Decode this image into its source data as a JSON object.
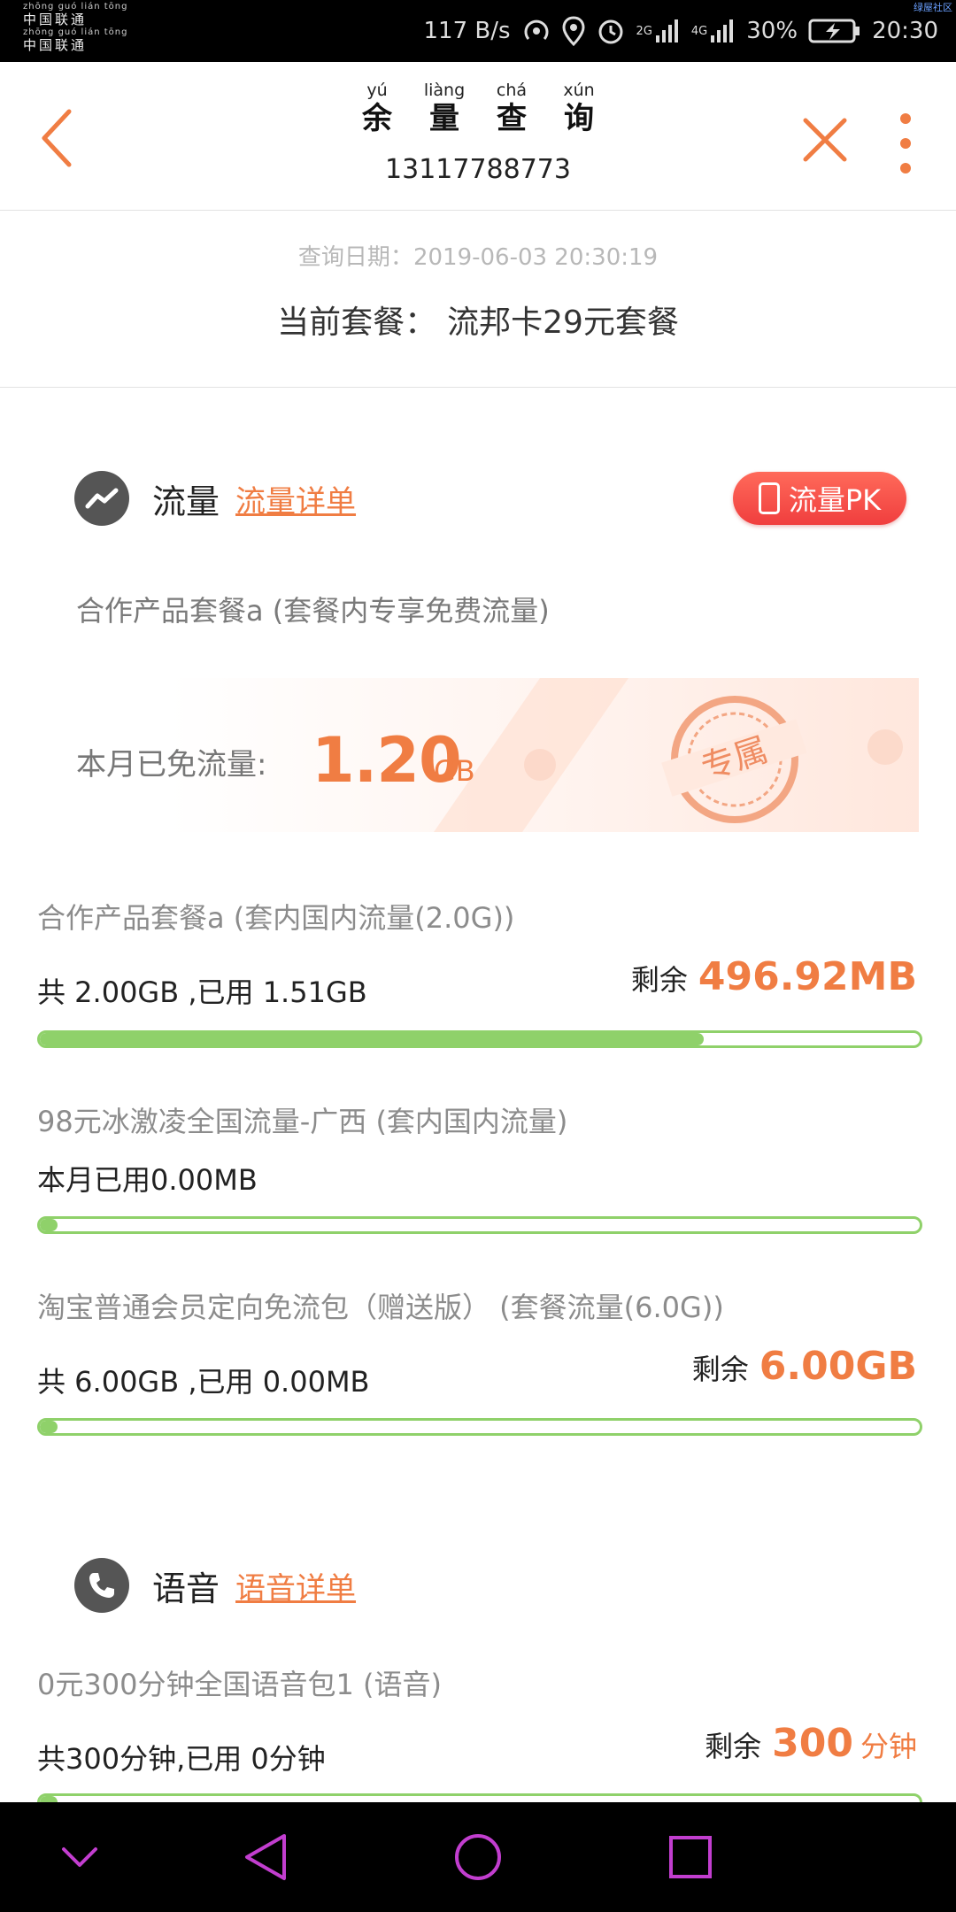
{
  "status_bar": {
    "carrier_pinyin": "zhōng guó lián tōng",
    "carrier_name": "中国联通",
    "speed": "117 B/s",
    "net1": "2G",
    "net2": "4G",
    "battery": "30%",
    "time": "20:30",
    "corner_tag": "绿屋社区"
  },
  "header": {
    "title_chars": [
      {
        "py": "yú",
        "hz": "余"
      },
      {
        "py": "liàng",
        "hz": "量"
      },
      {
        "py": "chá",
        "hz": "查"
      },
      {
        "py": "xún",
        "hz": "询"
      }
    ],
    "phone": "13117788773",
    "icons": [
      "back-icon",
      "close-icon",
      "more-icon"
    ]
  },
  "query": {
    "date_label": "查询日期：",
    "date_value": "2019-06-03 20:30:19",
    "plan_label": "当前套餐：",
    "plan_value": "流邦卡29元套餐"
  },
  "data_section": {
    "title": "流量",
    "link": "流量详单",
    "pk_label": "流量PK",
    "coop_name": "合作产品套餐a (套餐内专享免费流量)",
    "free_label": "本月已免流量:",
    "free_value": "1.20",
    "free_unit": "GB",
    "badge_text": "专属",
    "items": [
      {
        "name": "合作产品套餐a (套内国内流量(2.0G))",
        "used": "共 2.00GB ,已用 1.51GB",
        "remain_label": "剩余",
        "remain_value": "496.92MB",
        "remain_unit": "",
        "progress": 0.755
      },
      {
        "name": "98元冰激凌全国流量-广西 (套内国内流量)",
        "used": "本月已用0.00MB",
        "remain_label": "",
        "remain_value": "",
        "remain_unit": "",
        "progress": 0.0
      },
      {
        "name": "淘宝普通会员定向免流包（赠送版） (套餐流量(6.0G))",
        "used": "共 6.00GB ,已用 0.00MB",
        "remain_label": "剩余",
        "remain_value": "6.00GB",
        "remain_unit": "",
        "progress": 0.0
      }
    ]
  },
  "voice_section": {
    "title": "语音",
    "link": "语音详单",
    "items": [
      {
        "name": "0元300分钟全国语音包1 (语音)",
        "used": "共300分钟,已用 0分钟",
        "remain_label": "剩余",
        "remain_value": "300",
        "remain_unit": "分钟",
        "progress": 0.0
      }
    ]
  },
  "colors": {
    "accent": "#f07d43",
    "progress": "#8fd16a",
    "pk": "#f03e3e",
    "nav_icon": "#c23ecf"
  }
}
